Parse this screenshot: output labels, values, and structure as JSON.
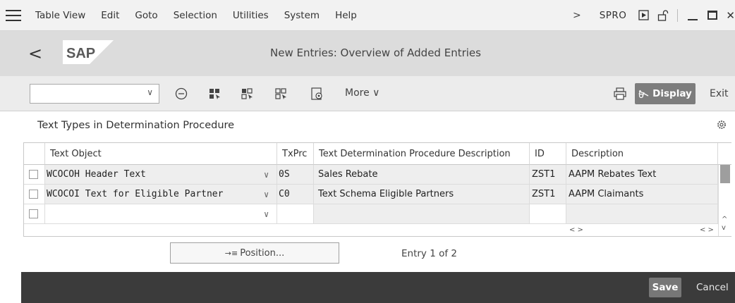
{
  "menubar": {
    "items": [
      "Table View",
      "Edit",
      "Goto",
      "Selection",
      "Utilities",
      "System",
      "Help"
    ],
    "transaction_code": "SPRO"
  },
  "titlebar": {
    "logo_text": "SAP",
    "title": "New Entries: Overview of Added Entries"
  },
  "toolbar": {
    "command_value": "",
    "more_label": "More",
    "display_label": "Display",
    "exit_label": "Exit"
  },
  "table": {
    "title": "Text Types in Determination Procedure",
    "columns": [
      "Text Object",
      "TxPrc",
      "Text Determination Procedure Description",
      "ID",
      "Description"
    ],
    "rows": [
      {
        "text_object": "WCOCOH Header Text",
        "txprc": "0S",
        "procedure_desc": "Sales Rebate",
        "id": "ZST1",
        "description": "AAPM Rebates Text"
      },
      {
        "text_object": "WCOCOI Text for Eligible Partner",
        "txprc": "C0",
        "procedure_desc": "Text Schema Eligible Partners",
        "id": "ZST1",
        "description": "AAPM Claimants"
      },
      {
        "text_object": "",
        "txprc": "",
        "procedure_desc": "",
        "id": "",
        "description": ""
      }
    ]
  },
  "position_label": "Position...",
  "entry_info": "Entry 1 of 2",
  "footer": {
    "save_label": "Save",
    "cancel_label": "Cancel"
  },
  "colors": {
    "title_bar": "#dcdcdc",
    "toolbar": "#ececec",
    "footer": "#3b3b3b",
    "primary_button": "#7d7d7d"
  },
  "icons": [
    "menu-icon",
    "back-icon",
    "collapse-icon",
    "select-all-icon",
    "select-block-icon",
    "deselect-all-icon",
    "configure-icon",
    "print-icon",
    "settings-icon"
  ]
}
